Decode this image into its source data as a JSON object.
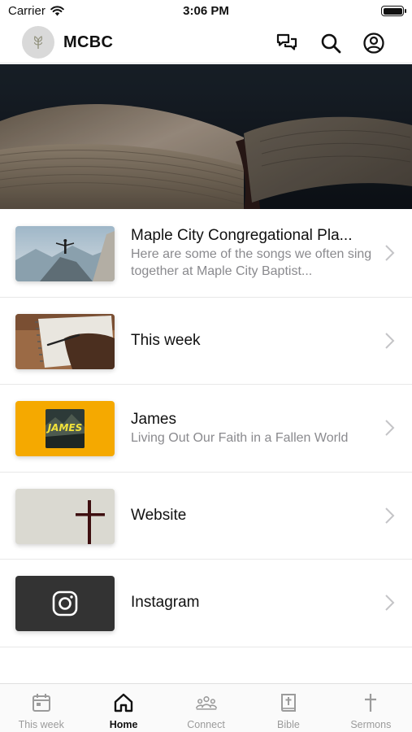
{
  "status_bar": {
    "carrier": "Carrier",
    "time": "3:06 PM"
  },
  "header": {
    "title": "MCBC",
    "icons": [
      "chat-icon",
      "search-icon",
      "account-icon"
    ]
  },
  "list_items": [
    {
      "title": "Maple City Congregational Pla...",
      "subtitle": "Here are some of the songs we often sing together at Maple City Baptist..."
    },
    {
      "title": "This week",
      "subtitle": ""
    },
    {
      "title": "James",
      "subtitle": "Living Out Our Faith in a Fallen World",
      "thumb_text": "JAMES"
    },
    {
      "title": "Website",
      "subtitle": ""
    },
    {
      "title": "Instagram",
      "subtitle": ""
    }
  ],
  "tabs": [
    {
      "label": "This week",
      "icon": "calendar-icon",
      "active": false
    },
    {
      "label": "Home",
      "icon": "home-icon",
      "active": true
    },
    {
      "label": "Connect",
      "icon": "people-icon",
      "active": false
    },
    {
      "label": "Bible",
      "icon": "bible-icon",
      "active": false
    },
    {
      "label": "Sermons",
      "icon": "cross-icon",
      "active": false
    }
  ],
  "colors": {
    "accent": "#111111",
    "inactive": "#9b9b9b",
    "james_bg": "#f5a900",
    "instagram_bg": "#333333"
  }
}
